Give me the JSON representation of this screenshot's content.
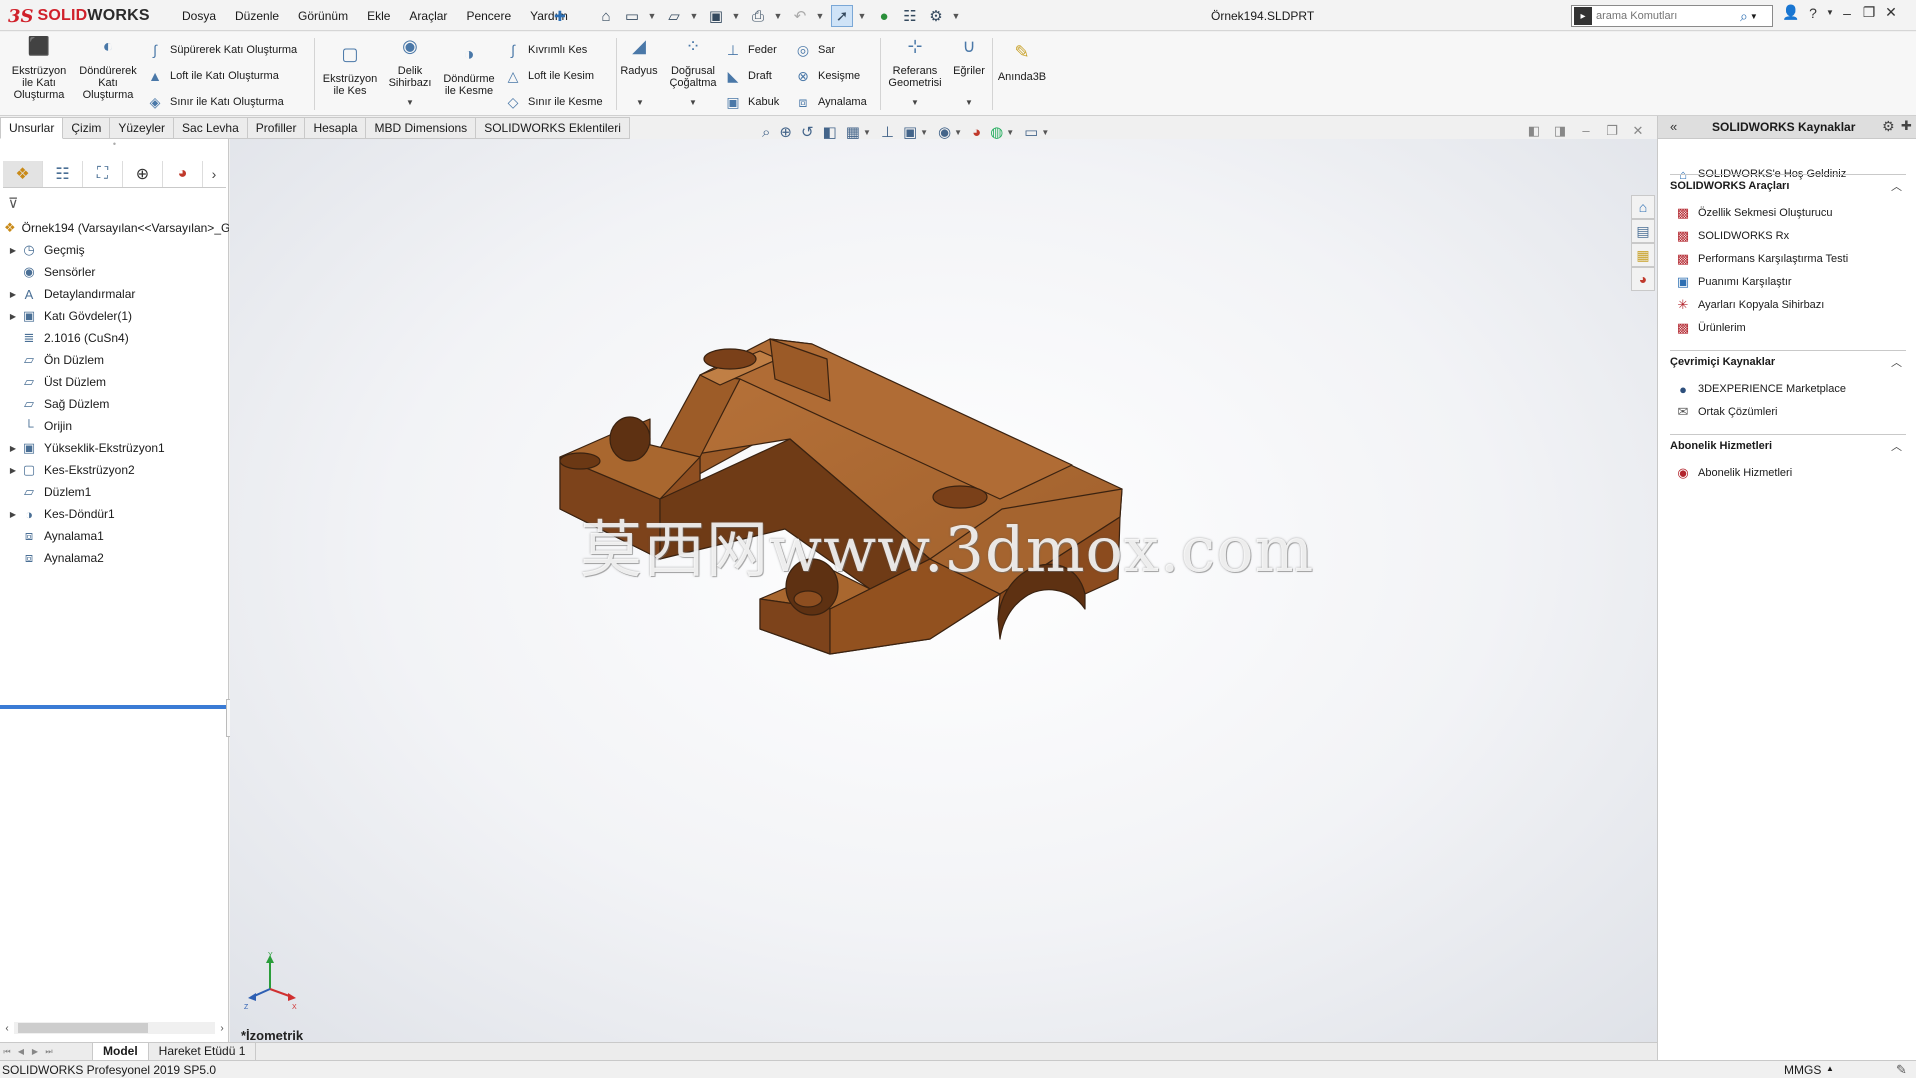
{
  "app": {
    "logo_ds": "3S",
    "logo_solid": "SOLID",
    "logo_works": "WORKS",
    "document_title": "Örnek194.SLDPRT"
  },
  "menu": [
    "Dosya",
    "Düzenle",
    "Görünüm",
    "Ekle",
    "Araçlar",
    "Pencere",
    "Yardım"
  ],
  "search": {
    "placeholder": "arama Komutları"
  },
  "ribbon": {
    "extrude_boss": "Ekstrüzyon\nile Katı\nOluşturma",
    "revolve_boss": "Döndürerek\nKatı\nOluşturma",
    "swept_boss": "Süpürerek Katı Oluşturma",
    "loft_boss": "Loft ile Katı Oluşturma",
    "boundary_boss": "Sınır ile Katı Oluşturma",
    "extrude_cut": "Ekstrüzyon\nile Kes",
    "hole_wizard": "Delik\nSihirbazı",
    "revolve_cut": "Döndürme\nile Kesme",
    "swept_cut": "Kıvrımlı Kes",
    "loft_cut": "Loft ile Kesim",
    "boundary_cut": "Sınır ile Kesme",
    "fillet": "Radyus",
    "linear_pattern": "Doğrusal\nÇoğaltma",
    "rib": "Feder",
    "draft": "Draft",
    "shell": "Kabuk",
    "wrap": "Sar",
    "intersect": "Kesişme",
    "mirror": "Aynalama",
    "ref_geometry": "Referans\nGeometrisi",
    "curves": "Eğriler",
    "instant3d": "Anında3B"
  },
  "command_tabs": [
    "Unsurlar",
    "Çizim",
    "Yüzeyler",
    "Sac Levha",
    "Profiller",
    "Hesapla",
    "MBD Dimensions",
    "SOLIDWORKS Eklentileri"
  ],
  "feature_tree": {
    "root": "Örnek194  (Varsayılan<<Varsayılan>_G",
    "items": [
      {
        "label": "Geçmiş",
        "icon": "history-icon",
        "expandable": true
      },
      {
        "label": "Sensörler",
        "icon": "sensor-icon",
        "expandable": false
      },
      {
        "label": "Detaylandırmalar",
        "icon": "annotation-icon",
        "expandable": true
      },
      {
        "label": "Katı Gövdeler(1)",
        "icon": "solid-bodies-icon",
        "expandable": true
      },
      {
        "label": "2.1016 (CuSn4)",
        "icon": "material-icon",
        "expandable": false
      },
      {
        "label": "Ön Düzlem",
        "icon": "plane-icon",
        "expandable": false
      },
      {
        "label": "Üst Düzlem",
        "icon": "plane-icon",
        "expandable": false
      },
      {
        "label": "Sağ Düzlem",
        "icon": "plane-icon",
        "expandable": false
      },
      {
        "label": "Orijin",
        "icon": "origin-icon",
        "expandable": false
      },
      {
        "label": "Yükseklik-Ekstrüzyon1",
        "icon": "boss-extrude-icon",
        "expandable": true
      },
      {
        "label": "Kes-Ekstrüzyon2",
        "icon": "cut-extrude-icon",
        "expandable": true
      },
      {
        "label": "Düzlem1",
        "icon": "plane-icon",
        "expandable": false
      },
      {
        "label": "Kes-Döndür1",
        "icon": "cut-revolve-icon",
        "expandable": true
      },
      {
        "label": "Aynalama1",
        "icon": "mirror-icon",
        "expandable": false
      },
      {
        "label": "Aynalama2",
        "icon": "mirror-icon",
        "expandable": false
      }
    ]
  },
  "graphics": {
    "watermark": "莫西网www.3dmox.com",
    "view_name": "*İzometrik",
    "part_color": "#a8622a"
  },
  "model_tabs": [
    "Model",
    "Hareket Etüdü 1"
  ],
  "status": {
    "text": "SOLIDWORKS Profesyonel 2019 SP5.0",
    "units": "MMGS"
  },
  "task_pane": {
    "title": "SOLIDWORKS Kaynaklar",
    "welcome": "SOLIDWORKS'e Hoş Geldiniz",
    "sections": [
      {
        "title": "SOLIDWORKS Araçları",
        "items": [
          "Özellik Sekmesi Oluşturucu",
          "SOLIDWORKS Rx",
          "Performans Karşılaştırma Testi",
          "Puanımı Karşılaştır",
          "Ayarları Kopyala Sihirbazı",
          "Ürünlerim"
        ]
      },
      {
        "title": "Çevrimiçi Kaynaklar",
        "items": [
          "3DEXPERIENCE Marketplace",
          "Ortak Çözümleri"
        ]
      },
      {
        "title": "Abonelik Hizmetleri",
        "items": [
          "Abonelik Hizmetleri"
        ]
      }
    ]
  }
}
